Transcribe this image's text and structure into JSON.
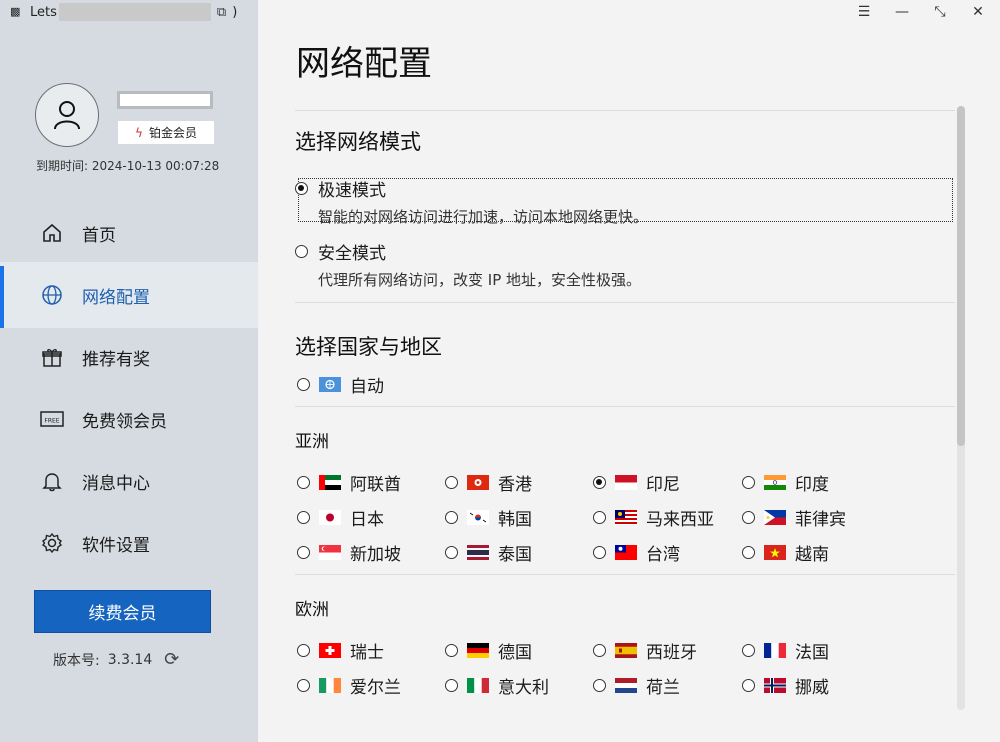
{
  "app": {
    "title": "Lets"
  },
  "window": {
    "menu_icon": "hamburger-icon",
    "minimize_icon": "minimize-icon",
    "restore_icon": "restore-icon",
    "close_icon": "close-icon"
  },
  "profile": {
    "badge_label": "铂金会员",
    "expiry": "到期时间: 2024-10-13 00:07:28"
  },
  "nav": {
    "items": [
      {
        "label": "首页",
        "icon": "home-icon"
      },
      {
        "label": "网络配置",
        "icon": "globe-icon",
        "active": true
      },
      {
        "label": "推荐有奖",
        "icon": "gift-icon"
      },
      {
        "label": "免费领会员",
        "icon": "free-ticket-icon"
      },
      {
        "label": "消息中心",
        "icon": "bell-icon"
      },
      {
        "label": "软件设置",
        "icon": "gear-icon"
      }
    ]
  },
  "sidebar_footer": {
    "renew_label": "续费会员",
    "version_label": "版本号:",
    "version": "3.3.14"
  },
  "main": {
    "title": "网络配置",
    "mode_section": {
      "title": "选择网络模式",
      "modes": [
        {
          "label": "极速模式",
          "desc": "智能的对网络访问进行加速，访问本地网络更快。",
          "selected": true
        },
        {
          "label": "安全模式",
          "desc": "代理所有网络访问，改变 IP 地址，安全性极强。",
          "selected": false
        }
      ]
    },
    "region_section": {
      "title": "选择国家与地区",
      "auto_label": "自动",
      "asia_title": "亚洲",
      "europe_title": "欧洲",
      "asia": [
        {
          "label": "阿联酋",
          "flag": "uae"
        },
        {
          "label": "香港",
          "flag": "hk"
        },
        {
          "label": "印尼",
          "flag": "id",
          "selected": true
        },
        {
          "label": "印度",
          "flag": "in"
        },
        {
          "label": "日本",
          "flag": "jp"
        },
        {
          "label": "韩国",
          "flag": "kr"
        },
        {
          "label": "马来西亚",
          "flag": "my"
        },
        {
          "label": "菲律宾",
          "flag": "ph"
        },
        {
          "label": "新加坡",
          "flag": "sg"
        },
        {
          "label": "泰国",
          "flag": "th"
        },
        {
          "label": "台湾",
          "flag": "tw"
        },
        {
          "label": "越南",
          "flag": "vn"
        }
      ],
      "europe": [
        {
          "label": "瑞士",
          "flag": "ch"
        },
        {
          "label": "德国",
          "flag": "de"
        },
        {
          "label": "西班牙",
          "flag": "es"
        },
        {
          "label": "法国",
          "flag": "fr"
        },
        {
          "label": "爱尔兰",
          "flag": "ie"
        },
        {
          "label": "意大利",
          "flag": "it"
        },
        {
          "label": "荷兰",
          "flag": "nl"
        },
        {
          "label": "挪威",
          "flag": "no"
        }
      ]
    }
  },
  "colors": {
    "accent": "#1565c0",
    "sidebar_bg": "#d6dbe1",
    "active_nav_bg": "#e4e9ee",
    "main_bg": "#f3f3f3"
  }
}
